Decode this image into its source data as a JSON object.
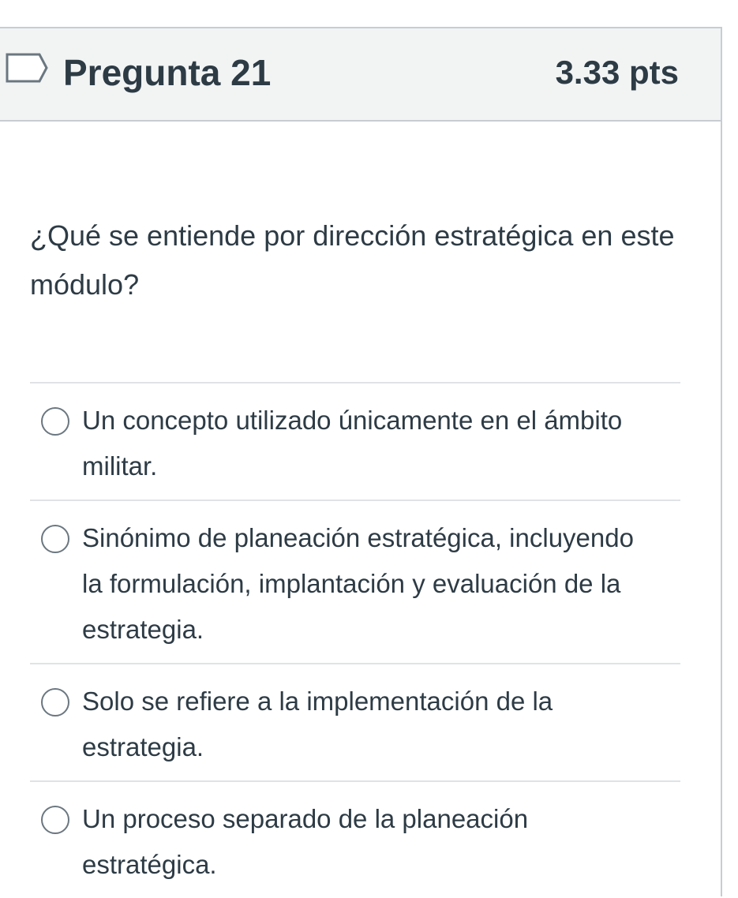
{
  "question": {
    "title": "Pregunta 21",
    "points": "3.33 pts",
    "text": "¿Qué se entiende por dirección estratégica en este módulo?",
    "flag_icon": "flag-outline-icon"
  },
  "answers": [
    {
      "label": "Un concepto utilizado únicamente en el ámbito militar.",
      "selected": false
    },
    {
      "label": "Sinónimo de planeación estratégica, incluyendo la formulación, implantación y evaluación de la estrategia.",
      "selected": false
    },
    {
      "label": "Solo se refiere a la implementación de la estrategia.",
      "selected": false
    },
    {
      "label": "Un proceso separado de la planeación estratégica.",
      "selected": false
    }
  ],
  "colors": {
    "header_bg": "#f2f4f4",
    "border": "#c7cdd1",
    "text": "#2d3b45",
    "radio_border": "#6b7780"
  }
}
